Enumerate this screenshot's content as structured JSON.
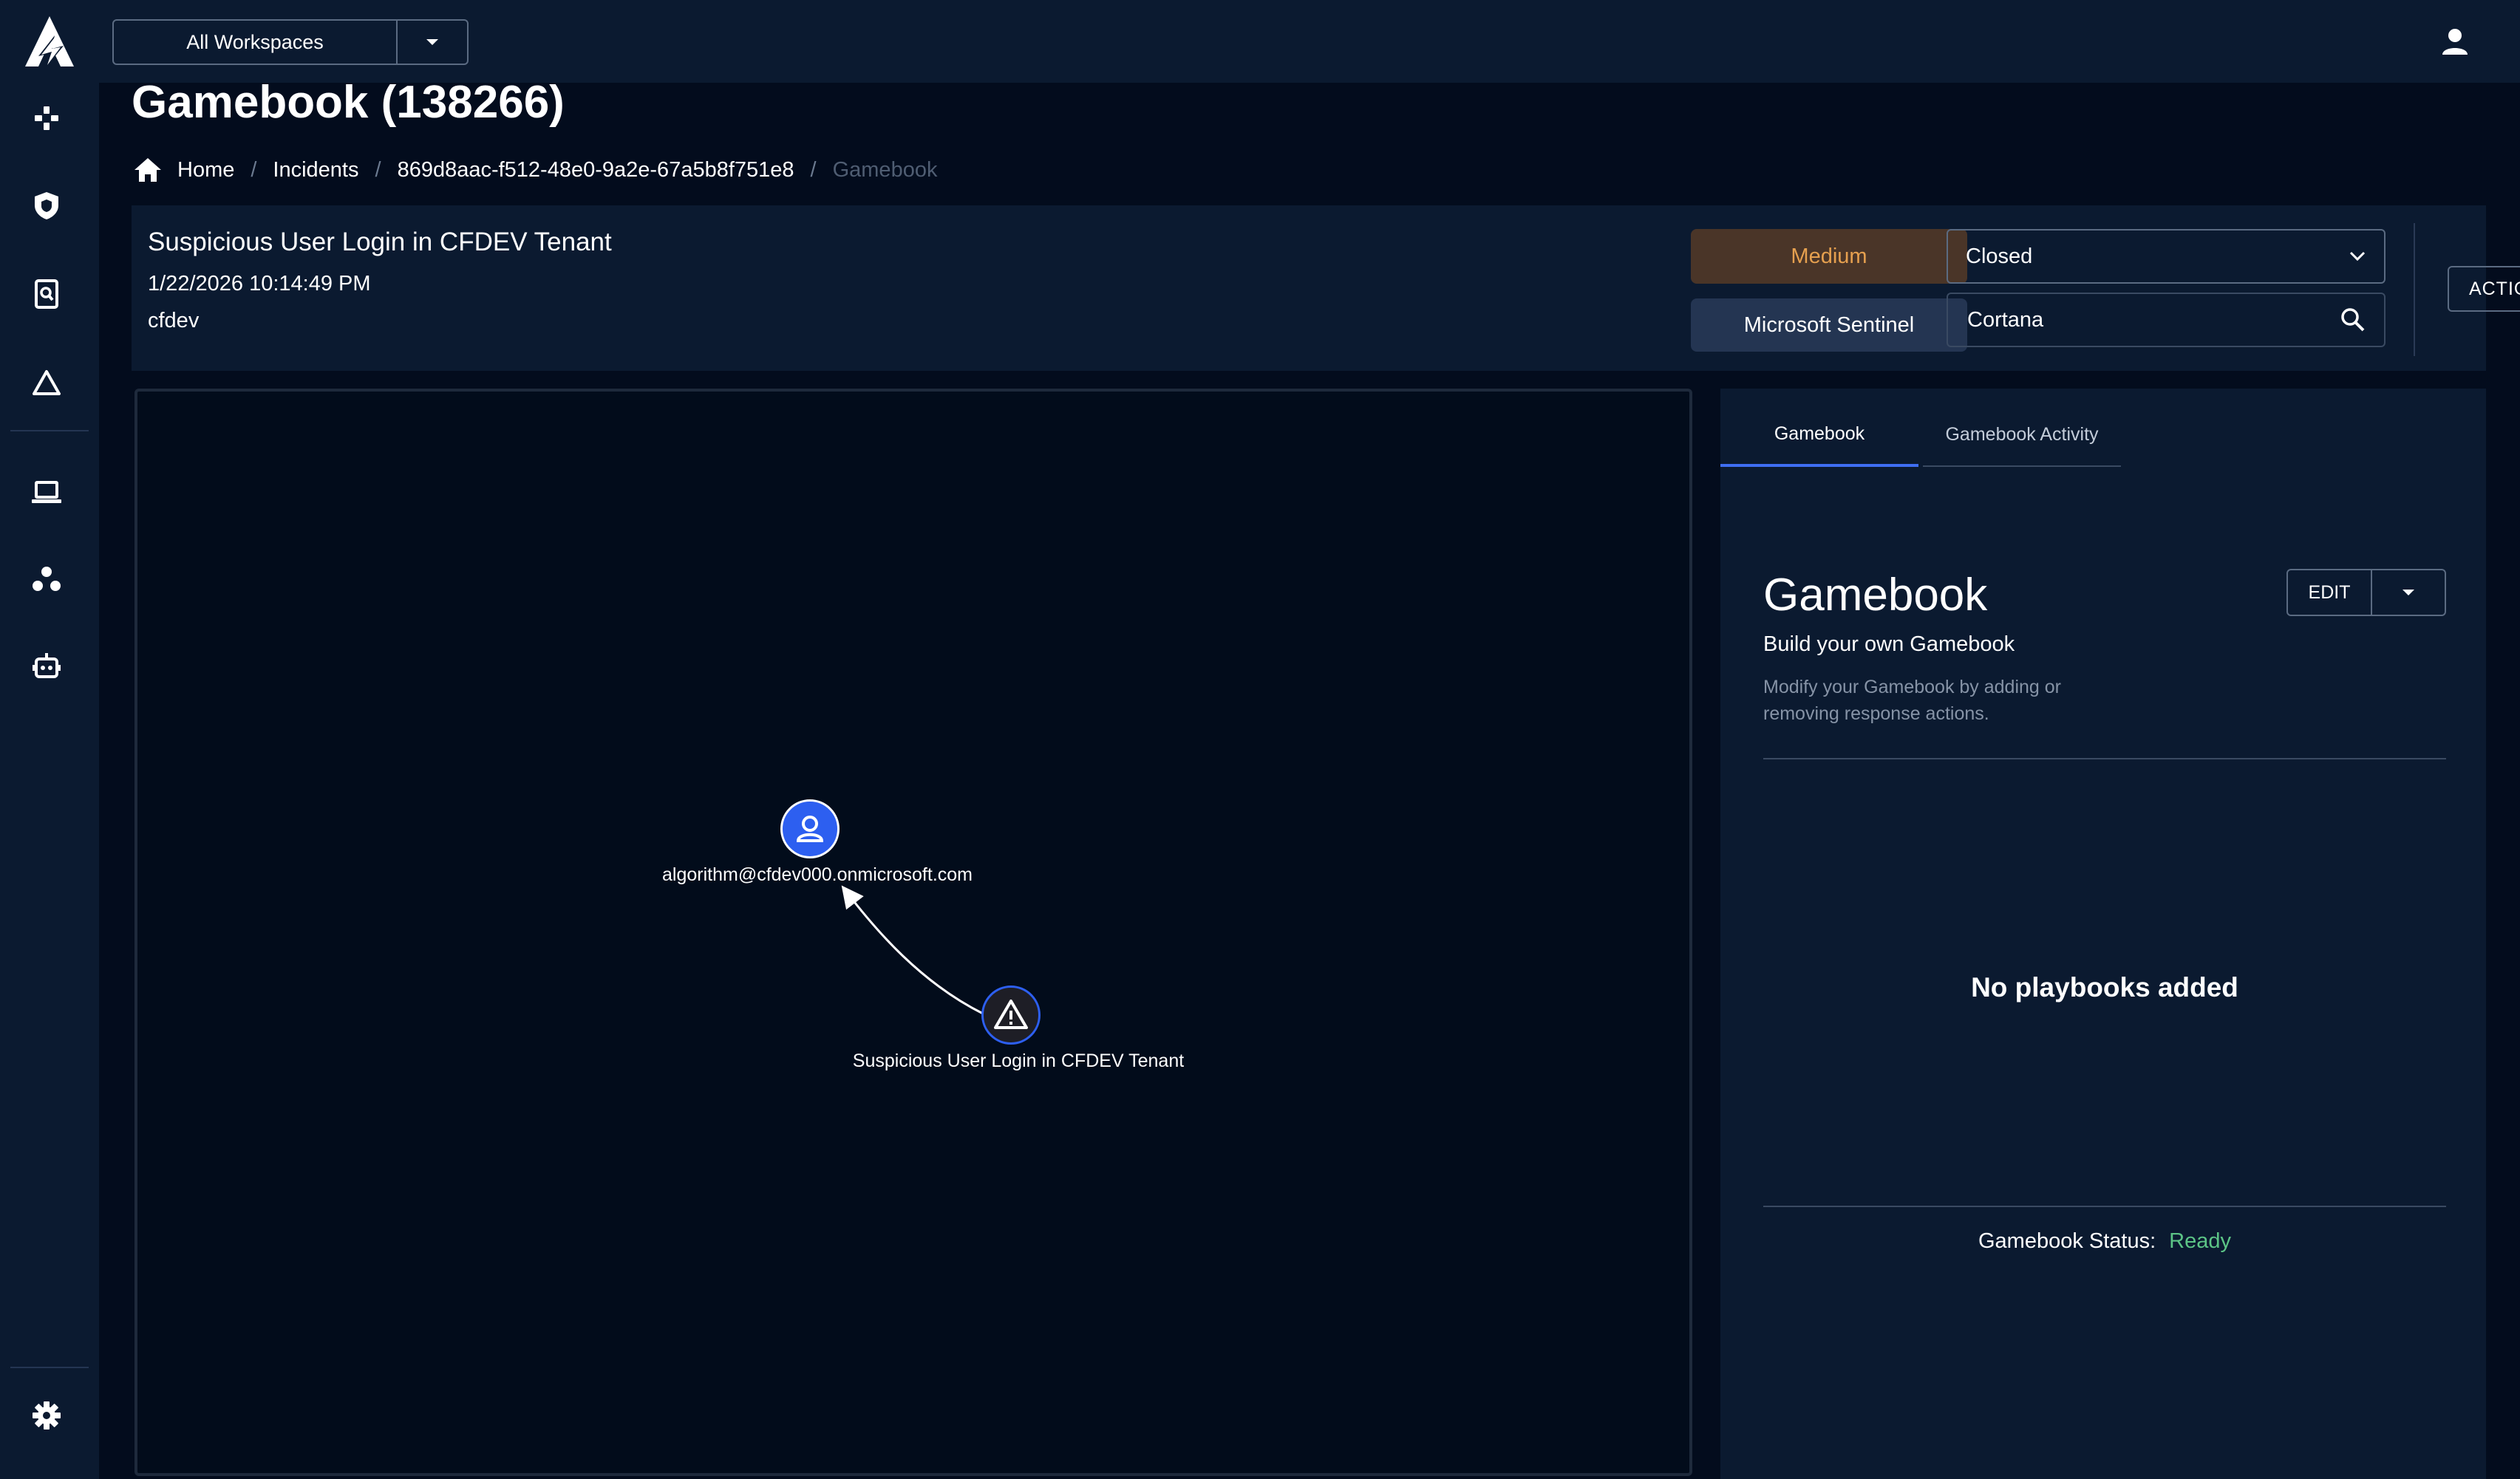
{
  "header": {
    "workspace_select": "All Workspaces"
  },
  "page": {
    "title": "Gamebook (138266)",
    "breadcrumb": [
      "Home",
      "Incidents",
      "869d8aac-f512-48e0-9a2e-67a5b8f751e8",
      "Gamebook"
    ]
  },
  "incident": {
    "title": "Suspicious User Login in CFDEV Tenant",
    "datetime": "1/22/2026 10:14:49 PM",
    "workspace": "cfdev",
    "severity": "Medium",
    "source": "Microsoft Sentinel",
    "status": "Closed",
    "assignee": "Cortana",
    "actions_label": "ACTIONS"
  },
  "graph": {
    "nodes": [
      {
        "label": "algorithm@cfdev000.onmicrosoft.com",
        "icon": "user-icon"
      },
      {
        "label": "Suspicious User Login in CFDEV Tenant",
        "icon": "warning-icon"
      }
    ]
  },
  "panel": {
    "tabs": [
      "Gamebook",
      "Gamebook Activity"
    ],
    "heading": "Gamebook",
    "subheading": "Build your own Gamebook",
    "description": "Modify your Gamebook by adding or removing response actions.",
    "edit_label": "EDIT",
    "empty_message": "No playbooks added",
    "status_label": "Gamebook Status:",
    "status_value": "Ready"
  },
  "colors": {
    "background": "#030c1d",
    "panel": "#0b1a30",
    "accent": "#3f6ef2",
    "severity_medium": "#e6a04f",
    "status_ready": "#5cc486"
  },
  "sidebar_icons": [
    "logo",
    "gamepad-icon",
    "shield-icon",
    "search-doc-icon",
    "alert-triangle-icon",
    "laptop-icon",
    "users-group-icon",
    "robot-icon",
    "settings-gear-icon"
  ]
}
